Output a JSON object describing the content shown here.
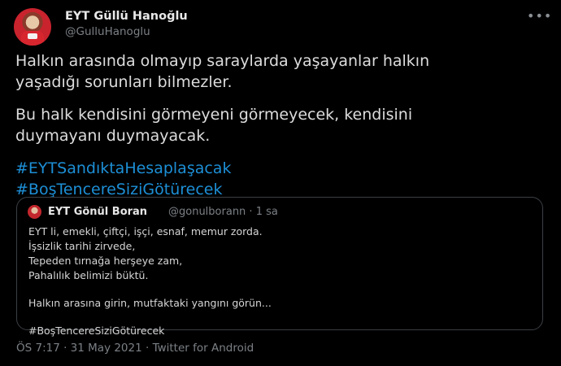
{
  "author": {
    "display_name": "EYT Güllü Hanoğlu",
    "handle": "@GulluHanoglu"
  },
  "more_icon": "more-horizontal-icon",
  "tweet": {
    "lines_1": [
      "Halkın arasında olmayıp saraylarda yaşayanlar halkın",
      "yaşadığı sorunları bilmezler."
    ],
    "lines_2": [
      "Bu halk kendisini görmeyeni görmeyecek, kendisini",
      "duymayanı duymayacak."
    ],
    "hashtags": [
      "#EYTSandıktaHesaplaşacak",
      "#BoşTencereSiziGötürecek"
    ]
  },
  "quote": {
    "display_name": "EYT Gönül Boran",
    "handle_time": "@gonulborann · 1 sa",
    "lines_1": [
      "EYT li, emekli, çiftçi, işçi, esnaf, memur zorda.",
      "İşsizlik tarihi zirvede,",
      "Tepeden tırnağa herşeye zam,",
      "Pahalılık belimizi büktü."
    ],
    "line_2": "Halkın arasına girin, mutfaktaki yangını görün...",
    "hashtag": "#BoşTencereSiziGötürecek"
  },
  "meta": "ÖS 7:17 · 31 May 2021 · Twitter for Android",
  "colors": {
    "background": "#000000",
    "link": "#1d8fd6",
    "muted": "#7b8085"
  }
}
